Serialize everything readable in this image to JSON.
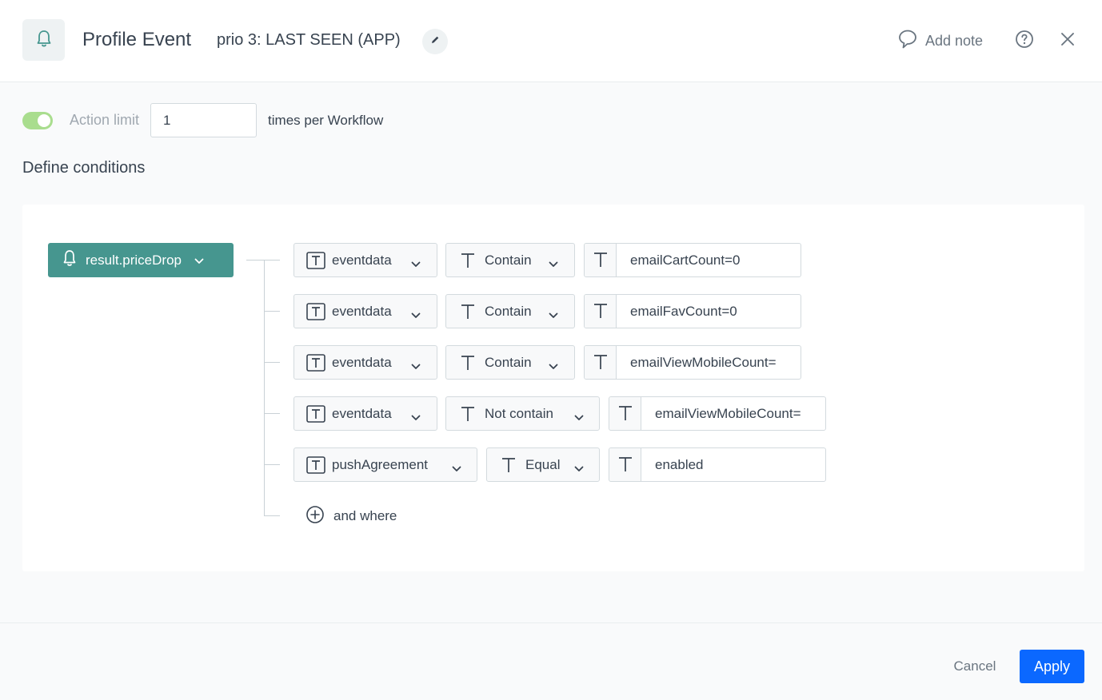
{
  "header": {
    "title": "Profile Event",
    "subtitle": "prio 3: LAST SEEN (APP)",
    "add_note_label": "Add note"
  },
  "action_limit": {
    "enabled": true,
    "label": "Action limit",
    "value": "1",
    "suffix": "times per Workflow"
  },
  "conditions": {
    "title": "Define conditions",
    "event_name": "result.priceDrop",
    "rows": [
      {
        "parameter": "eventdata",
        "operator": "Contain",
        "value": "emailCartCount=0"
      },
      {
        "parameter": "eventdata",
        "operator": "Contain",
        "value": "emailFavCount=0"
      },
      {
        "parameter": "eventdata",
        "operator": "Contain",
        "value": "emailViewMobileCount="
      },
      {
        "parameter": "eventdata",
        "operator": "Not contain",
        "value": "emailViewMobileCount="
      },
      {
        "parameter": "pushAgreement",
        "operator": "Equal",
        "value": "enabled"
      }
    ],
    "add_label": "and where"
  },
  "footer": {
    "cancel_label": "Cancel",
    "apply_label": "Apply"
  },
  "icons": {
    "event": "bell-icon",
    "edit": "pencil-icon",
    "note": "speech-bubble-icon",
    "help": "question-circle-icon",
    "close": "close-icon",
    "text_type": "text-type-icon",
    "dropdown": "chevron-down-icon",
    "add": "plus-circle-icon"
  },
  "colors": {
    "event_pill": "#46968f",
    "event_icon": "#46968f",
    "toggle_on": "#a9dd8e",
    "primary": "#0b68ff"
  }
}
